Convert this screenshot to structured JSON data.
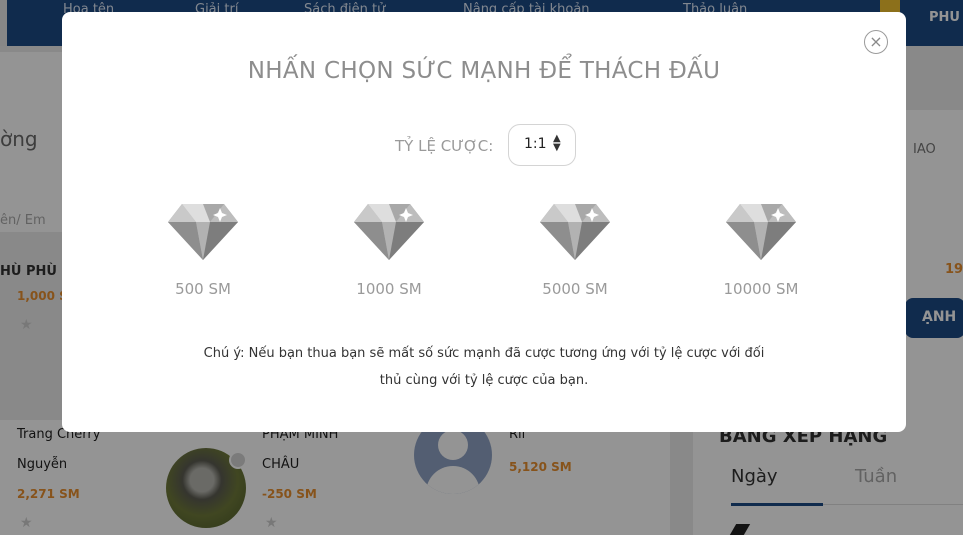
{
  "nav": {
    "items": [
      "Họa tên",
      "Giải trí",
      "Sách điện tử",
      "Nâng cấp tài khoản",
      "Thảo luận"
    ],
    "right_label": "PHU"
  },
  "background": {
    "left_heading": "ờng",
    "left_input": "ên/ Em",
    "left_name": "HÙ PHÙ",
    "left_points": "1,000 S",
    "right_top_label": "IAO",
    "right_number": "19",
    "right_button": "ẠNH",
    "players": [
      {
        "name_line1": "Trang Cherry",
        "name_line2": "Nguyễn",
        "points": "2,271 SM"
      },
      {
        "name_line1": "PHẠM MINH",
        "name_line2": "CHÂU",
        "points": "-250 SM"
      },
      {
        "name_line1": "Rii",
        "name_line2": "",
        "points": "5,120 SM"
      }
    ],
    "leaderboard_title": "BẢNG XẾP HẠNG",
    "tabs": [
      "Ngày",
      "Tuần"
    ]
  },
  "modal": {
    "title": "NHẤN CHỌN SỨC MẠNH ĐỂ THÁCH ĐẤU",
    "close_icon": "×",
    "ratio_label": "TỶ LỆ CƯỢC:",
    "ratio_value": "1:1",
    "options": [
      {
        "label": "500 SM"
      },
      {
        "label": "1000 SM"
      },
      {
        "label": "5000 SM"
      },
      {
        "label": "10000 SM"
      }
    ],
    "note_line1": "Chú ý: Nếu bạn thua bạn sẽ mất số sức mạnh đã cược tương ứng với tỷ lệ cược với đối",
    "note_line2": "thủ cùng với tỷ lệ cược của bạn."
  },
  "colors": {
    "nav_blue": "#1d4a86",
    "points_orange": "#e8902f",
    "diamond_gray": "#9a9a9a"
  },
  "icons": [
    "close-icon",
    "diamond-icon",
    "select-arrows-icon",
    "star-icon",
    "user-avatar-icon",
    "pen-icon"
  ]
}
